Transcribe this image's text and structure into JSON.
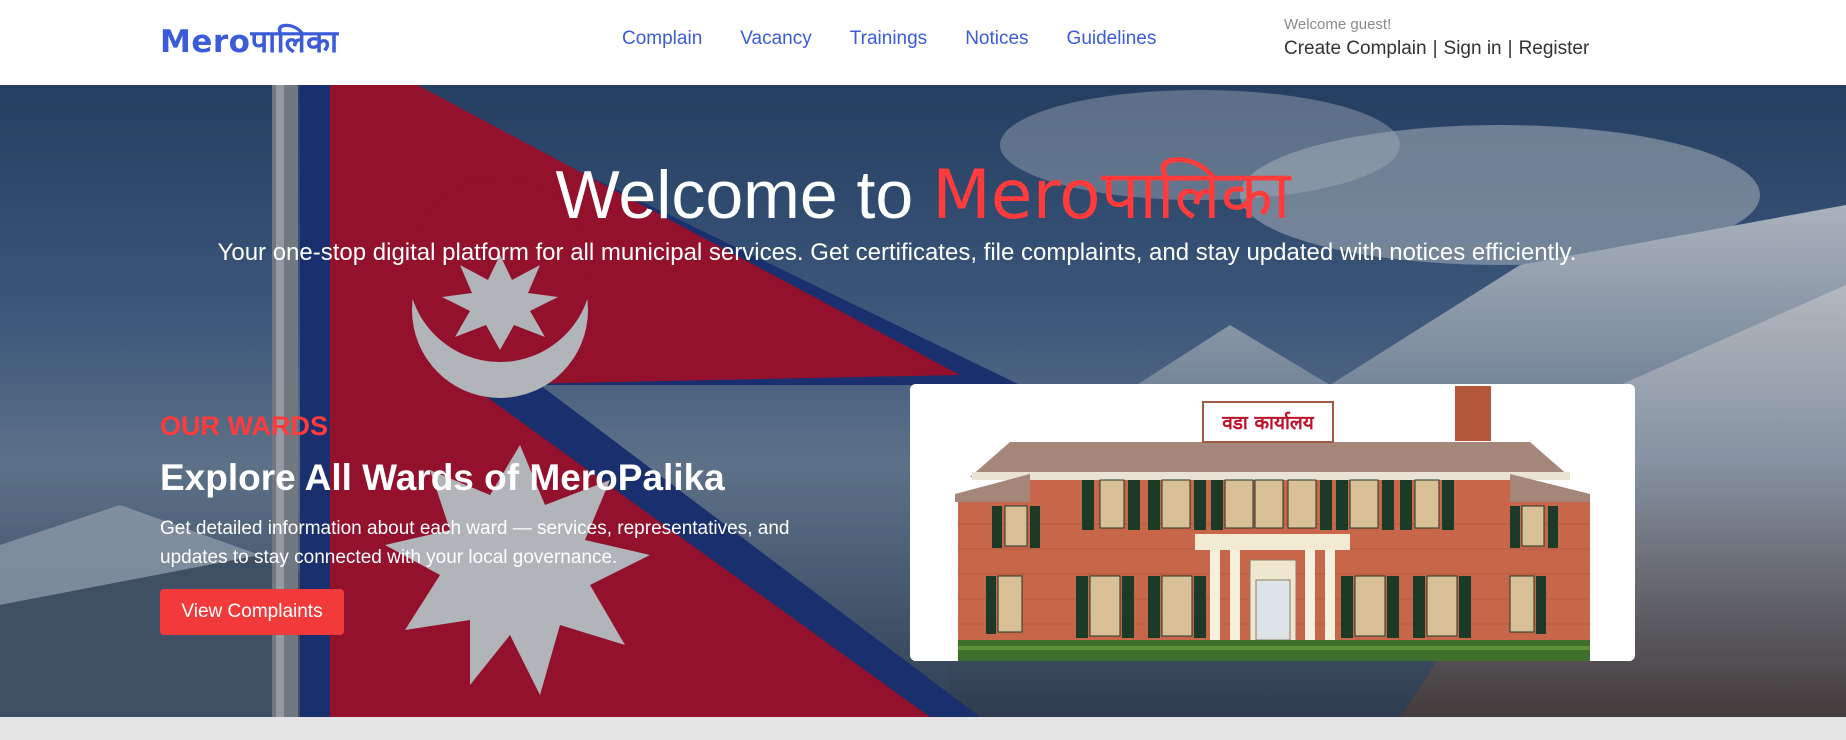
{
  "header": {
    "logo": "Meroपालिका",
    "nav": [
      "Complain",
      "Vacancy",
      "Trainings",
      "Notices",
      "Guidelines"
    ],
    "welcome": "Welcome guest!",
    "auth": {
      "create": "Create Complain",
      "signin": "Sign in",
      "register": "Register",
      "separator": "|"
    }
  },
  "hero": {
    "title_prefix": "Welcome to ",
    "title_brand": "Meroपालिका",
    "subtitle": "Your one-stop digital platform for all municipal services. Get certificates, file complaints, and stay updated with notices efficiently."
  },
  "wards": {
    "label": "OUR WARDS",
    "title": "Explore All Wards of MeroPalika",
    "description": "Get detailed information about each ward — services, representatives, and updates to stay connected with your local governance.",
    "button": "View Complaints",
    "image_sign": "वडा कार्यालय"
  },
  "colors": {
    "accent": "#3b5bdb",
    "brand_red": "#ff3b3b",
    "button_red": "#f23a3a"
  }
}
